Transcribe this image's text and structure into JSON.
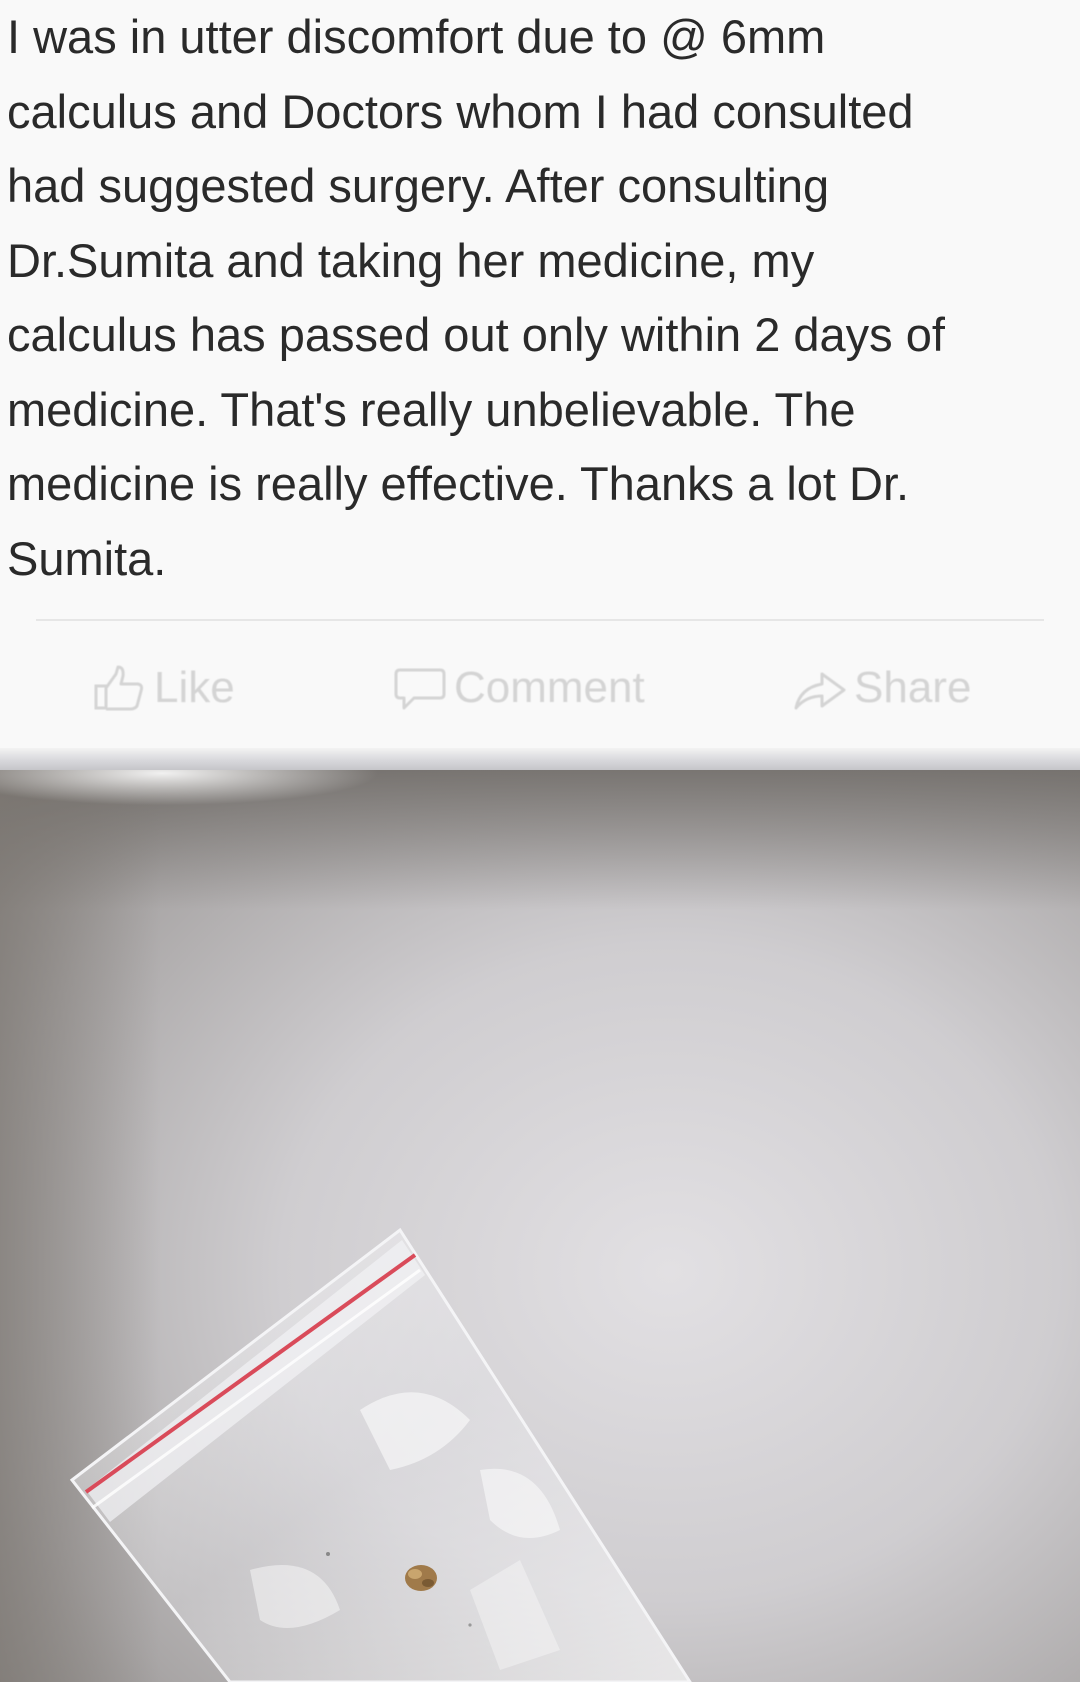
{
  "post": {
    "text": "I was in utter discomfort due to @ 6mm\ncalculus and Doctors whom I had consulted\nhad suggested surgery. After consulting\nDr.Sumita and taking her medicine, my\ncalculus has passed out only within 2 days of\nmedicine. That's really unbelievable. The\nmedicine is really effective. Thanks a lot Dr.\nSumita."
  },
  "actions": {
    "like_label": "Like",
    "comment_label": "Comment",
    "share_label": "Share",
    "like_icon": "thumbs-up-icon",
    "comment_icon": "speech-bubble-icon",
    "share_icon": "share-arrow-icon"
  },
  "photo": {
    "subject": "small stone in a clear zip-lock bag with red seal line on a white surface"
  },
  "colors": {
    "post_background": "#f9f9f9",
    "text": "#2a2a2a",
    "faded_action": "#d4d4d4",
    "bag_seal": "#d94b5a",
    "stone": "#a07a4a"
  }
}
